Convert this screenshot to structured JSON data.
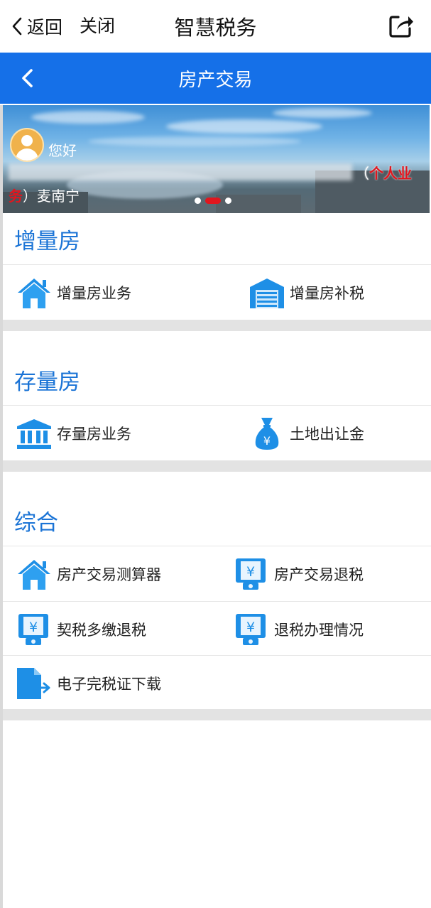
{
  "topbar": {
    "back_label": "返回",
    "close_label": "关闭",
    "title": "智慧税务",
    "share_icon": "share-icon"
  },
  "navbar": {
    "title": "房产交易",
    "back_icon": "chevron-left-icon"
  },
  "banner": {
    "greeting": "您好",
    "user_type": "个人业务",
    "user_type_line1": "个人业",
    "user_type_line2": "务",
    "paren_open": "（",
    "paren_close": "）",
    "name": "麦南宁",
    "carousel_active_index": 1,
    "carousel_count": 3
  },
  "sections": [
    {
      "title": "增量房",
      "items": [
        {
          "label": "增量房业务",
          "icon": "house-icon"
        },
        {
          "label": "增量房补税",
          "icon": "garage-icon"
        }
      ]
    },
    {
      "title": "存量房",
      "items": [
        {
          "label": "存量房业务",
          "icon": "bank-icon"
        },
        {
          "label": "土地出让金",
          "icon": "money-bag-icon"
        }
      ]
    },
    {
      "title": "综合",
      "items": [
        {
          "label": "房产交易测算器",
          "icon": "house-icon"
        },
        {
          "label": "房产交易退税",
          "icon": "tax-refund-icon"
        },
        {
          "label": "契税多缴退税",
          "icon": "tax-refund-icon"
        },
        {
          "label": "退税办理情况",
          "icon": "tax-refund-icon"
        },
        {
          "label": "电子完税证下载",
          "icon": "document-download-icon"
        }
      ]
    }
  ],
  "colors": {
    "nav_blue": "#1570e8",
    "section_title_blue": "#1b74d6",
    "icon_blue": "#1e8fe6",
    "accent_red": "#e0161e"
  }
}
